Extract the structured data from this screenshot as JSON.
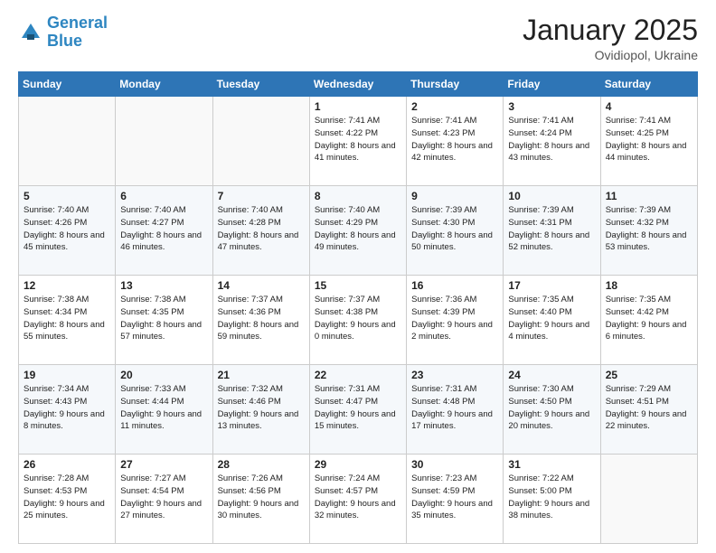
{
  "logo": {
    "line1": "General",
    "line2": "Blue"
  },
  "title": "January 2025",
  "subtitle": "Ovidiopol, Ukraine",
  "weekdays": [
    "Sunday",
    "Monday",
    "Tuesday",
    "Wednesday",
    "Thursday",
    "Friday",
    "Saturday"
  ],
  "weeks": [
    [
      null,
      null,
      null,
      {
        "day": "1",
        "sunrise": "7:41 AM",
        "sunset": "4:22 PM",
        "daylight": "8 hours and 41 minutes."
      },
      {
        "day": "2",
        "sunrise": "7:41 AM",
        "sunset": "4:23 PM",
        "daylight": "8 hours and 42 minutes."
      },
      {
        "day": "3",
        "sunrise": "7:41 AM",
        "sunset": "4:24 PM",
        "daylight": "8 hours and 43 minutes."
      },
      {
        "day": "4",
        "sunrise": "7:41 AM",
        "sunset": "4:25 PM",
        "daylight": "8 hours and 44 minutes."
      }
    ],
    [
      {
        "day": "5",
        "sunrise": "7:40 AM",
        "sunset": "4:26 PM",
        "daylight": "8 hours and 45 minutes."
      },
      {
        "day": "6",
        "sunrise": "7:40 AM",
        "sunset": "4:27 PM",
        "daylight": "8 hours and 46 minutes."
      },
      {
        "day": "7",
        "sunrise": "7:40 AM",
        "sunset": "4:28 PM",
        "daylight": "8 hours and 47 minutes."
      },
      {
        "day": "8",
        "sunrise": "7:40 AM",
        "sunset": "4:29 PM",
        "daylight": "8 hours and 49 minutes."
      },
      {
        "day": "9",
        "sunrise": "7:39 AM",
        "sunset": "4:30 PM",
        "daylight": "8 hours and 50 minutes."
      },
      {
        "day": "10",
        "sunrise": "7:39 AM",
        "sunset": "4:31 PM",
        "daylight": "8 hours and 52 minutes."
      },
      {
        "day": "11",
        "sunrise": "7:39 AM",
        "sunset": "4:32 PM",
        "daylight": "8 hours and 53 minutes."
      }
    ],
    [
      {
        "day": "12",
        "sunrise": "7:38 AM",
        "sunset": "4:34 PM",
        "daylight": "8 hours and 55 minutes."
      },
      {
        "day": "13",
        "sunrise": "7:38 AM",
        "sunset": "4:35 PM",
        "daylight": "8 hours and 57 minutes."
      },
      {
        "day": "14",
        "sunrise": "7:37 AM",
        "sunset": "4:36 PM",
        "daylight": "8 hours and 59 minutes."
      },
      {
        "day": "15",
        "sunrise": "7:37 AM",
        "sunset": "4:38 PM",
        "daylight": "9 hours and 0 minutes."
      },
      {
        "day": "16",
        "sunrise": "7:36 AM",
        "sunset": "4:39 PM",
        "daylight": "9 hours and 2 minutes."
      },
      {
        "day": "17",
        "sunrise": "7:35 AM",
        "sunset": "4:40 PM",
        "daylight": "9 hours and 4 minutes."
      },
      {
        "day": "18",
        "sunrise": "7:35 AM",
        "sunset": "4:42 PM",
        "daylight": "9 hours and 6 minutes."
      }
    ],
    [
      {
        "day": "19",
        "sunrise": "7:34 AM",
        "sunset": "4:43 PM",
        "daylight": "9 hours and 8 minutes."
      },
      {
        "day": "20",
        "sunrise": "7:33 AM",
        "sunset": "4:44 PM",
        "daylight": "9 hours and 11 minutes."
      },
      {
        "day": "21",
        "sunrise": "7:32 AM",
        "sunset": "4:46 PM",
        "daylight": "9 hours and 13 minutes."
      },
      {
        "day": "22",
        "sunrise": "7:31 AM",
        "sunset": "4:47 PM",
        "daylight": "9 hours and 15 minutes."
      },
      {
        "day": "23",
        "sunrise": "7:31 AM",
        "sunset": "4:48 PM",
        "daylight": "9 hours and 17 minutes."
      },
      {
        "day": "24",
        "sunrise": "7:30 AM",
        "sunset": "4:50 PM",
        "daylight": "9 hours and 20 minutes."
      },
      {
        "day": "25",
        "sunrise": "7:29 AM",
        "sunset": "4:51 PM",
        "daylight": "9 hours and 22 minutes."
      }
    ],
    [
      {
        "day": "26",
        "sunrise": "7:28 AM",
        "sunset": "4:53 PM",
        "daylight": "9 hours and 25 minutes."
      },
      {
        "day": "27",
        "sunrise": "7:27 AM",
        "sunset": "4:54 PM",
        "daylight": "9 hours and 27 minutes."
      },
      {
        "day": "28",
        "sunrise": "7:26 AM",
        "sunset": "4:56 PM",
        "daylight": "9 hours and 30 minutes."
      },
      {
        "day": "29",
        "sunrise": "7:24 AM",
        "sunset": "4:57 PM",
        "daylight": "9 hours and 32 minutes."
      },
      {
        "day": "30",
        "sunrise": "7:23 AM",
        "sunset": "4:59 PM",
        "daylight": "9 hours and 35 minutes."
      },
      {
        "day": "31",
        "sunrise": "7:22 AM",
        "sunset": "5:00 PM",
        "daylight": "9 hours and 38 minutes."
      },
      null
    ]
  ]
}
